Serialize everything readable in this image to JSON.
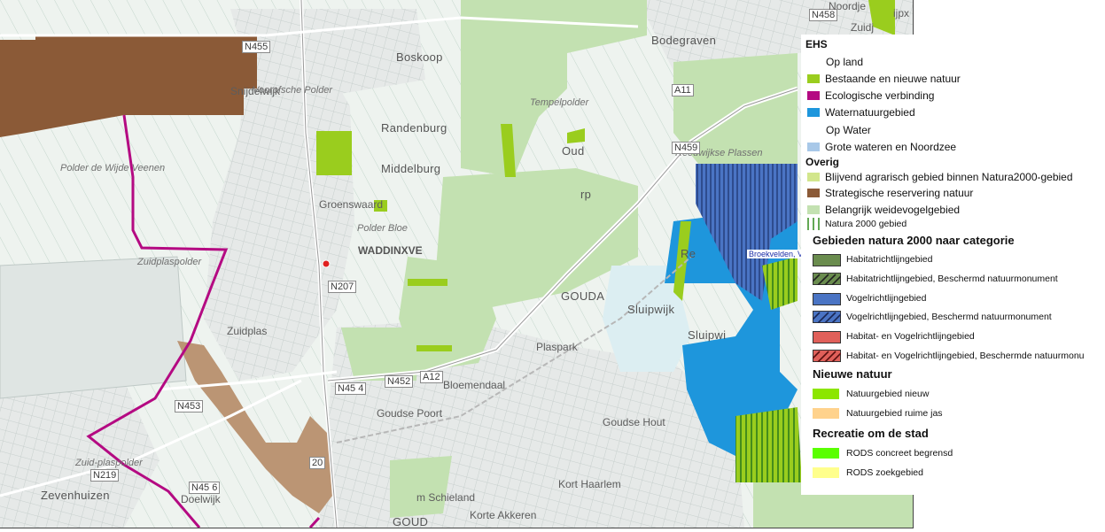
{
  "map": {
    "places": [
      {
        "key": "bodegraven",
        "text": "Bodegraven"
      },
      {
        "key": "boskoop",
        "text": "Boskoop"
      },
      {
        "key": "randenburg",
        "text": "Randenburg"
      },
      {
        "key": "middelburg",
        "text": "Middelburg"
      },
      {
        "key": "waddinxveen",
        "text": "WADDINXVE"
      },
      {
        "key": "gouda",
        "text": "GOUDA"
      },
      {
        "key": "sluipwijk",
        "text": "Sluipwijk"
      },
      {
        "key": "sluipwijk2",
        "text": "Sluipwi"
      },
      {
        "key": "oud",
        "text": "Oud"
      },
      {
        "key": "rp",
        "text": "rp"
      },
      {
        "key": "re",
        "text": "Re"
      },
      {
        "key": "zevenhuizen",
        "text": "Zevenhuizen"
      },
      {
        "key": "gouda_bottom",
        "text": "GOUD"
      },
      {
        "key": "zuidplas",
        "text": "Zuidplas"
      },
      {
        "key": "bloemendaal",
        "text": "Bloemendaal"
      },
      {
        "key": "goudse_poort",
        "text": "Goudse Poort"
      },
      {
        "key": "doelwijk",
        "text": "Doelwijk"
      },
      {
        "key": "korte_akkeren",
        "text": "Korte Akkeren"
      },
      {
        "key": "kort_haarlem",
        "text": "Kort Haarlem"
      },
      {
        "key": "schieland",
        "text": "m Schieland"
      },
      {
        "key": "randenburg_small",
        "text": "Snijdelwijk"
      },
      {
        "key": "goudse_hout",
        "text": "Goudse Hout"
      },
      {
        "key": "plaslaan",
        "text": "Plaspark"
      },
      {
        "key": "groenswaard",
        "text": "Groenswaard"
      }
    ],
    "italic_places": [
      {
        "key": "voorofsche",
        "text": "Voorofsche Polder"
      },
      {
        "key": "polder_wijde",
        "text": "Polder de Wijde Veenen"
      },
      {
        "key": "zuidplaspolder",
        "text": "Zuidplaspolder"
      },
      {
        "key": "zuidplaspolder2",
        "text": "Zuid-plaspolder"
      },
      {
        "key": "tempelpolder",
        "text": "Tempelpolder"
      },
      {
        "key": "reeuwijkse",
        "text": "Reeuwijkse Plassen"
      },
      {
        "key": "polder_bloem",
        "text": "Polder Bloe"
      }
    ],
    "roads": [
      {
        "key": "n455",
        "text": "N455"
      },
      {
        "key": "n458",
        "text": "N458"
      },
      {
        "key": "a11",
        "text": "A11"
      },
      {
        "key": "n459",
        "text": "N459"
      },
      {
        "key": "n207",
        "text": "N207"
      },
      {
        "key": "n454",
        "text": "N45 4"
      },
      {
        "key": "n452",
        "text": "N452"
      },
      {
        "key": "a12",
        "text": "A12"
      },
      {
        "key": "n453",
        "text": "N453"
      },
      {
        "key": "n219",
        "text": "N219"
      },
      {
        "key": "n456",
        "text": "N45 6"
      },
      {
        "key": "r20",
        "text": "20"
      }
    ],
    "blue_label": "Broekvelden, V",
    "top_right_labels": {
      "noorden": "Noordje",
      "ijpx": "ijpx",
      "zuidj": "Zuidj"
    },
    "marker_color": "#e02020"
  },
  "legend": {
    "ehs_title": "EHS",
    "op_land": "Op land",
    "bestaande": "Bestaande en nieuwe natuur",
    "ecologische": "Ecologische verbinding",
    "waternatuur": "Waternatuurgebied",
    "op_water": "Op Water",
    "grote_wateren": "Grote wateren en Noordzee",
    "overig_title": "Overig",
    "blijvend": "Blijvend agrarisch gebied binnen Natura2000-gebied",
    "strategische": "Strategische reservering natuur",
    "belangrijk": "Belangrijk weidevogelgebied",
    "natura2000": "Natura 2000 gebied",
    "gebieden_title": "Gebieden natura 2000 naar categorie",
    "habitatrichtlijn": "Habitatrichtlijngebied",
    "habitatrichtlijn_bn": "Habitatrichtlijngebied, Beschermd natuurmonument",
    "vogelrichtlijn": "Vogelrichtlijngebied",
    "vogelrichtlijn_bn": "Vogelrichtlijngebied, Beschermd natuurmonument",
    "habitat_vogel": "Habitat- en Vogelrichtlijngebied",
    "habitat_vogel_bn": "Habitat- en Vogelrichtlijngebied, Beschermde natuurmonu",
    "nieuwe_title": "Nieuwe natuur",
    "natuur_nieuw": "Natuurgebied nieuw",
    "natuur_ruime": "Natuurgebied ruime jas",
    "recreatie_title": "Recreatie om de stad",
    "rods_concreet": "RODS concreet begrensd",
    "rods_zoek": "RODS zoekgebied"
  },
  "colors": {
    "bestaande": "#9acd1e",
    "ecologische": "#b40a82",
    "waternatuur": "#1e96dc",
    "grote_wateren": "#a8c8e8",
    "blijvend": "#d2e68c",
    "strategische": "#8b5a37",
    "belangrijk": "#c3e1b1",
    "natura_hatch": "#2f8a1c",
    "habitatrichtlijn": "#6a8c4e",
    "vogelrichtlijn": "#4a74c4",
    "habitat_vogel": "#e0605a",
    "natuur_nieuw": "#8ce600",
    "natuur_ruime": "#ffd28c",
    "rods_concreet": "#5aff00",
    "rods_zoek": "#ffff8c"
  }
}
